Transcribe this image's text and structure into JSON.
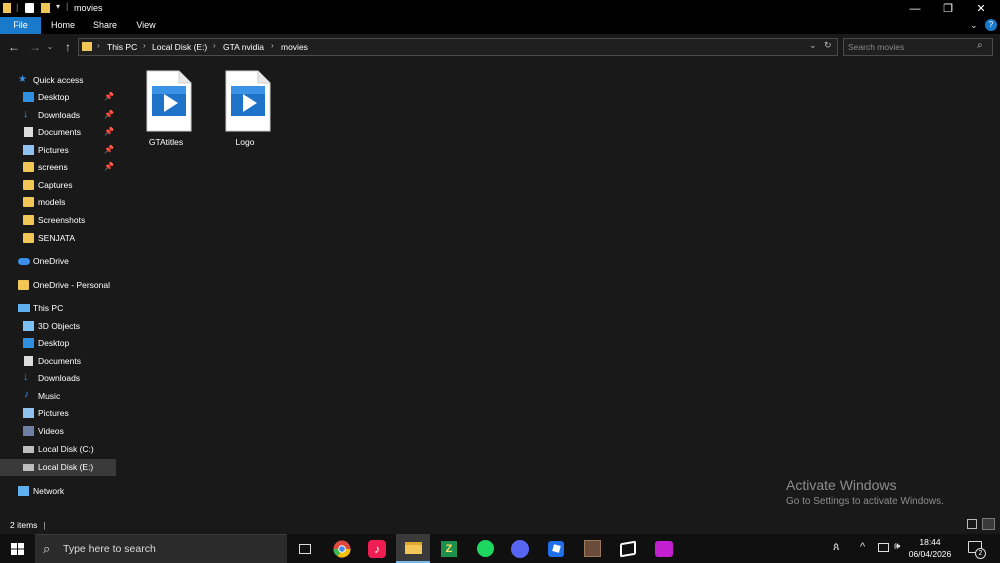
{
  "window": {
    "title": "movies",
    "ribbon_tabs": {
      "file": "File",
      "home": "Home",
      "share": "Share",
      "view": "View"
    }
  },
  "address": {
    "crumbs": [
      "This PC",
      "Local Disk (E:)",
      "GTA nvidia",
      "movies"
    ],
    "search_placeholder": "Search movies"
  },
  "nav": {
    "quick_access": "Quick access",
    "quick_items": [
      "Desktop",
      "Downloads",
      "Documents",
      "Pictures",
      "screens",
      "Captures",
      "models",
      "Screenshots",
      "SENJATA"
    ],
    "onedrive": "OneDrive",
    "onedrive_personal": "OneDrive - Personal",
    "this_pc": "This PC",
    "pc_items": [
      "3D Objects",
      "Desktop",
      "Documents",
      "Downloads",
      "Music",
      "Pictures",
      "Videos",
      "Local Disk (C:)",
      "Local Disk (E:)"
    ],
    "network": "Network"
  },
  "files": [
    {
      "name": "GTAtitles",
      "icon": "video-file-icon"
    },
    {
      "name": "Logo",
      "icon": "video-file-icon"
    }
  ],
  "status": {
    "item_count": "2 items"
  },
  "watermark": {
    "title": "Activate Windows",
    "subtitle": "Go to Settings to activate Windows."
  },
  "taskbar": {
    "search_placeholder": "Type here to search",
    "apps": [
      "task-view-icon",
      "chrome-icon",
      "tiktok-icon",
      "file-explorer-icon",
      "app-green-icon",
      "spotify-icon",
      "discord-icon",
      "roblox-icon",
      "game-icon",
      "capcut-icon",
      "music-app-icon"
    ],
    "time": "18:44",
    "date": "06/04/2026",
    "notification_count": "2"
  },
  "colors": {
    "accent": "#1979ca",
    "folder": "#f1c656",
    "background": "#191919"
  }
}
